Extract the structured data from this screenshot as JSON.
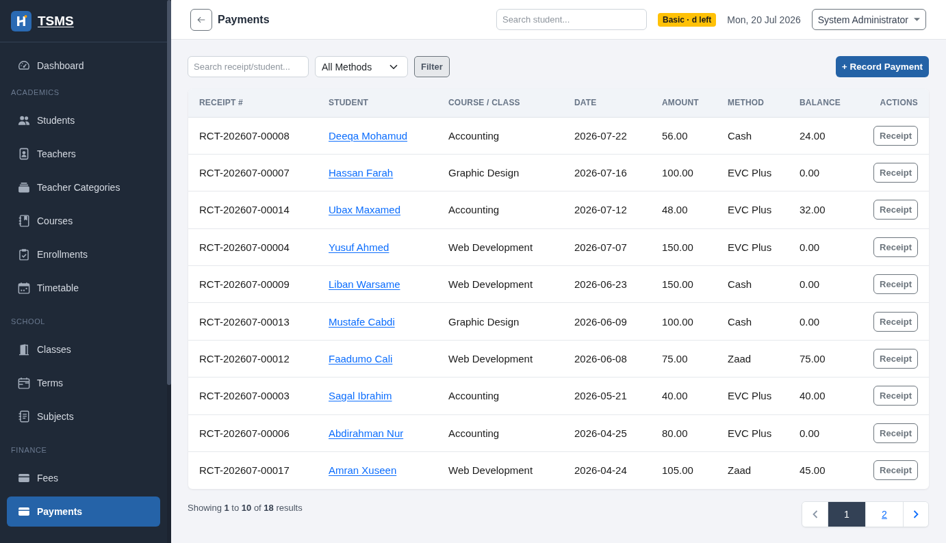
{
  "sidebar": {
    "brand": "TSMS",
    "items": [
      {
        "kind": "link",
        "label": "Dashboard",
        "selected": false
      },
      {
        "kind": "heading",
        "label": "ACADEMICS"
      },
      {
        "kind": "link",
        "label": "Students",
        "selected": false
      },
      {
        "kind": "link",
        "label": "Teachers",
        "selected": false
      },
      {
        "kind": "link",
        "label": "Teacher Categories",
        "selected": false
      },
      {
        "kind": "link",
        "label": "Courses",
        "selected": false
      },
      {
        "kind": "link",
        "label": "Enrollments",
        "selected": false
      },
      {
        "kind": "link",
        "label": "Timetable",
        "selected": false
      },
      {
        "kind": "heading",
        "label": "SCHOOL"
      },
      {
        "kind": "link",
        "label": "Classes",
        "selected": false
      },
      {
        "kind": "link",
        "label": "Terms",
        "selected": false
      },
      {
        "kind": "link",
        "label": "Subjects",
        "selected": false
      },
      {
        "kind": "heading",
        "label": "FINANCE"
      },
      {
        "kind": "link",
        "label": "Fees",
        "selected": false
      },
      {
        "kind": "link",
        "label": "Payments",
        "selected": true
      }
    ]
  },
  "topbar": {
    "title": "Payments",
    "search": {
      "placeholder": "Search student..."
    },
    "plan_badge": "Basic · d left",
    "date": "Mon, 20 Jul 2026",
    "user_menu": "System Administrator"
  },
  "toolbar": {
    "search": {
      "placeholder": "Search receipt/student..."
    },
    "method_filter": "All Methods",
    "filter_button": "Filter",
    "record_button": "+ Record Payment"
  },
  "table": {
    "columns": [
      "RECEIPT #",
      "STUDENT",
      "COURSE / CLASS",
      "DATE",
      "AMOUNT",
      "METHOD",
      "BALANCE",
      "ACTIONS"
    ],
    "rows": [
      {
        "receipt": "RCT-202607-00008",
        "student": "Deeqa Mohamud",
        "course": "Accounting",
        "date": "2026-07-22",
        "amount": "56.00",
        "method": "Cash",
        "balance": "24.00",
        "action": "Receipt"
      },
      {
        "receipt": "RCT-202607-00007",
        "student": "Hassan Farah",
        "course": "Graphic Design",
        "date": "2026-07-16",
        "amount": "100.00",
        "method": "EVC Plus",
        "balance": "0.00",
        "action": "Receipt"
      },
      {
        "receipt": "RCT-202607-00014",
        "student": "Ubax Maxamed",
        "course": "Accounting",
        "date": "2026-07-12",
        "amount": "48.00",
        "method": "EVC Plus",
        "balance": "32.00",
        "action": "Receipt"
      },
      {
        "receipt": "RCT-202607-00004",
        "student": "Yusuf Ahmed",
        "course": "Web Development",
        "date": "2026-07-07",
        "amount": "150.00",
        "method": "EVC Plus",
        "balance": "0.00",
        "action": "Receipt"
      },
      {
        "receipt": "RCT-202607-00009",
        "student": "Liban Warsame",
        "course": "Web Development",
        "date": "2026-06-23",
        "amount": "150.00",
        "method": "Cash",
        "balance": "0.00",
        "action": "Receipt"
      },
      {
        "receipt": "RCT-202607-00013",
        "student": "Mustafe Cabdi",
        "course": "Graphic Design",
        "date": "2026-06-09",
        "amount": "100.00",
        "method": "Cash",
        "balance": "0.00",
        "action": "Receipt"
      },
      {
        "receipt": "RCT-202607-00012",
        "student": "Faadumo Cali",
        "course": "Web Development",
        "date": "2026-06-08",
        "amount": "75.00",
        "method": "Zaad",
        "balance": "75.00",
        "action": "Receipt"
      },
      {
        "receipt": "RCT-202607-00003",
        "student": "Sagal Ibrahim",
        "course": "Accounting",
        "date": "2026-05-21",
        "amount": "40.00",
        "method": "EVC Plus",
        "balance": "40.00",
        "action": "Receipt"
      },
      {
        "receipt": "RCT-202607-00006",
        "student": "Abdirahman Nur",
        "course": "Accounting",
        "date": "2026-04-25",
        "amount": "80.00",
        "method": "EVC Plus",
        "balance": "0.00",
        "action": "Receipt"
      },
      {
        "receipt": "RCT-202607-00017",
        "student": "Amran Xuseen",
        "course": "Web Development",
        "date": "2026-04-24",
        "amount": "105.00",
        "method": "Zaad",
        "balance": "45.00",
        "action": "Receipt"
      }
    ]
  },
  "footer": {
    "summary": "Showing **1** to **10** of **18** results",
    "pagination": {
      "previous": {
        "disabled": true
      },
      "pages": [
        {
          "label": "1",
          "selected": true
        },
        {
          "label": "2",
          "selected": false
        }
      ],
      "next": {
        "disabled": false
      }
    }
  }
}
